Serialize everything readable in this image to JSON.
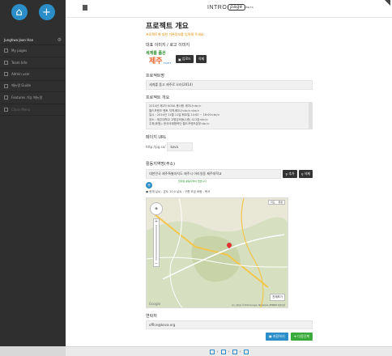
{
  "sidebar": {
    "user_name": "Junghwa Joon Han",
    "items": [
      {
        "label": "My pages"
      },
      {
        "label": "Team Info"
      },
      {
        "label": "Admin user"
      },
      {
        "label": "메뉴얼 Guide"
      },
      {
        "label": "Features 기능 매뉴얼"
      },
      {
        "label": "Close Menu"
      }
    ]
  },
  "header": {
    "logo_left": "INTRO",
    "logo_right": "page",
    "logo_sup": "BETA"
  },
  "main": {
    "title": "프로젝트 개요",
    "subtitle": "프로젝트에 대한 기본정보를 입력해 주세요.",
    "logo_section_label": "대표 이미지 / 로고 이미지",
    "logo_img": {
      "line1": "세계를 품은",
      "line2": "제주",
      "line3": "FIGHT"
    },
    "upload_label": "업로드",
    "delete_label": "삭제",
    "project_name_label": "프로젝트명",
    "project_name_value": "세계를 품고 제주로 오라(2014)",
    "overview_label": "프로젝트 개요",
    "overview_lines": [
      "2014년 제2차 KOVA 봉사왕 세미나<br/>",
      "월드프렌즈 멘토 지역세미나<br/><br/>",
      "일시 : 2014년 11월 11일 화요일 14:00 ~ 16:00<br/>",
      "장소 : 제주대학교 고명강의동(1층) 413호<br/>",
      "주최(후원): 한국국제협력단 월드프렌즈본부<br/>"
    ],
    "page_url_label": "페이지 URL",
    "url_prefix": "http://pg.so/",
    "url_value": "kova",
    "location_label": "활동지역명(주소)",
    "location_value": "대한민국 제주특별자치도 제주시 아라일동 제주대학교",
    "add_label": "추가",
    "delete2_label": "삭제",
    "hint_text": "입력된 활동지역이 없습니다",
    "weather": "현재 날씨 : 온도 10.0 날씨 : 구름 조금 바람 : 북서",
    "map": {
      "tab_map": "지도",
      "tab_satellite": "위성",
      "zoom_plus": "+",
      "zoom_minus": "−",
      "nav": "◈",
      "enlarge_label": "전체보기",
      "google": "Google",
      "footer": "지도 데이터 ©2014 Google, SK planet, ZENRIN 이용약관"
    },
    "contact_label": "연락처",
    "contact_value": "office@kova.org",
    "save_label": "저장하기",
    "next_label": "다음단계"
  },
  "bottombar": {
    "sep": "›"
  }
}
